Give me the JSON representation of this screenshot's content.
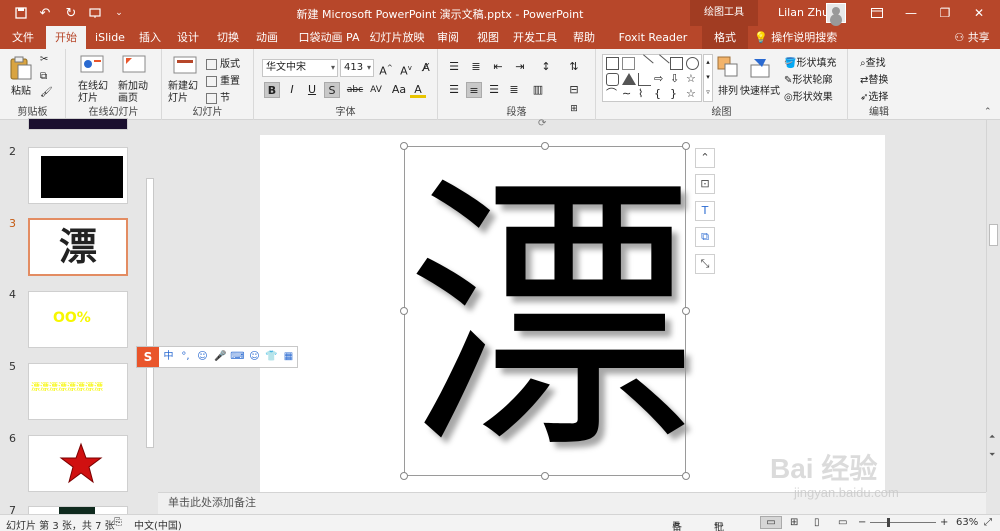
{
  "titlebar": {
    "title": "新建 Microsoft PowerPoint 演示文稿.pptx  -  PowerPoint",
    "context_label": "绘图工具",
    "user_name": "Lilan Zhu",
    "quick_access": [
      "save-icon",
      "undo-icon",
      "redo-icon",
      "start-slideshow-icon",
      "customize-icon"
    ]
  },
  "tabs": {
    "file": "文件",
    "home": "开始",
    "islide": "iSlide",
    "insert": "插入",
    "design": "设计",
    "transitions": "切换",
    "animations": "动画",
    "pocket": "口袋动画 PA",
    "slideshow": "幻灯片放映",
    "review": "审阅",
    "view": "视图",
    "developer": "开发工具",
    "help": "帮助",
    "foxit": "Foxit Reader PDF",
    "format": "格式",
    "tell_me": "操作说明搜索",
    "share": "共享"
  },
  "ribbon": {
    "clipboard": {
      "label": "剪贴板",
      "paste": "粘贴"
    },
    "online_slides": {
      "label": "在线幻灯片",
      "online": "在线幻灯片",
      "new_anim": "新加动画页"
    },
    "slides": {
      "label": "幻灯片",
      "new_slide": "新建幻灯片",
      "layout": "版式",
      "reset": "重置",
      "section": "节"
    },
    "font": {
      "label": "字体",
      "font_name": "华文中宋",
      "font_size": "413",
      "bold": "B",
      "italic": "I",
      "underline": "U",
      "shadow": "S",
      "strike": "abc",
      "case": "Aa",
      "color": "A"
    },
    "paragraph": {
      "label": "段落"
    },
    "drawing": {
      "label": "绘图",
      "arrange": "排列",
      "quick_styles": "快速样式",
      "shape_fill": "形状填充",
      "shape_outline": "形状轮廓",
      "shape_effects": "形状效果"
    },
    "editing": {
      "label": "编辑",
      "find": "查找",
      "replace": "替换",
      "select": "选择"
    }
  },
  "slides_panel": {
    "numbers": [
      "2",
      "3",
      "4",
      "5",
      "6",
      "7"
    ],
    "selected": "3",
    "slide3_char": "漂",
    "slide4_text": "OO%",
    "slide5_text": "漂漂漂漂漂漂漂漂"
  },
  "slide": {
    "main_char": "漂"
  },
  "notes": {
    "placeholder": "单击此处添加备注"
  },
  "ime": {
    "logo": "S",
    "items": [
      "中",
      "°,",
      "☺",
      "mic-icon",
      "keyboard-icon",
      "user-icon",
      "shirt-icon",
      "grid-icon"
    ]
  },
  "status": {
    "slide_info": "幻灯片 第 3 张，共 7 张",
    "language": "中文(中国)",
    "notes": "备注",
    "comments": "批注",
    "zoom": "63%"
  },
  "watermark": {
    "brand": "Bai 经验",
    "url": "jingyan.baidu.com"
  }
}
